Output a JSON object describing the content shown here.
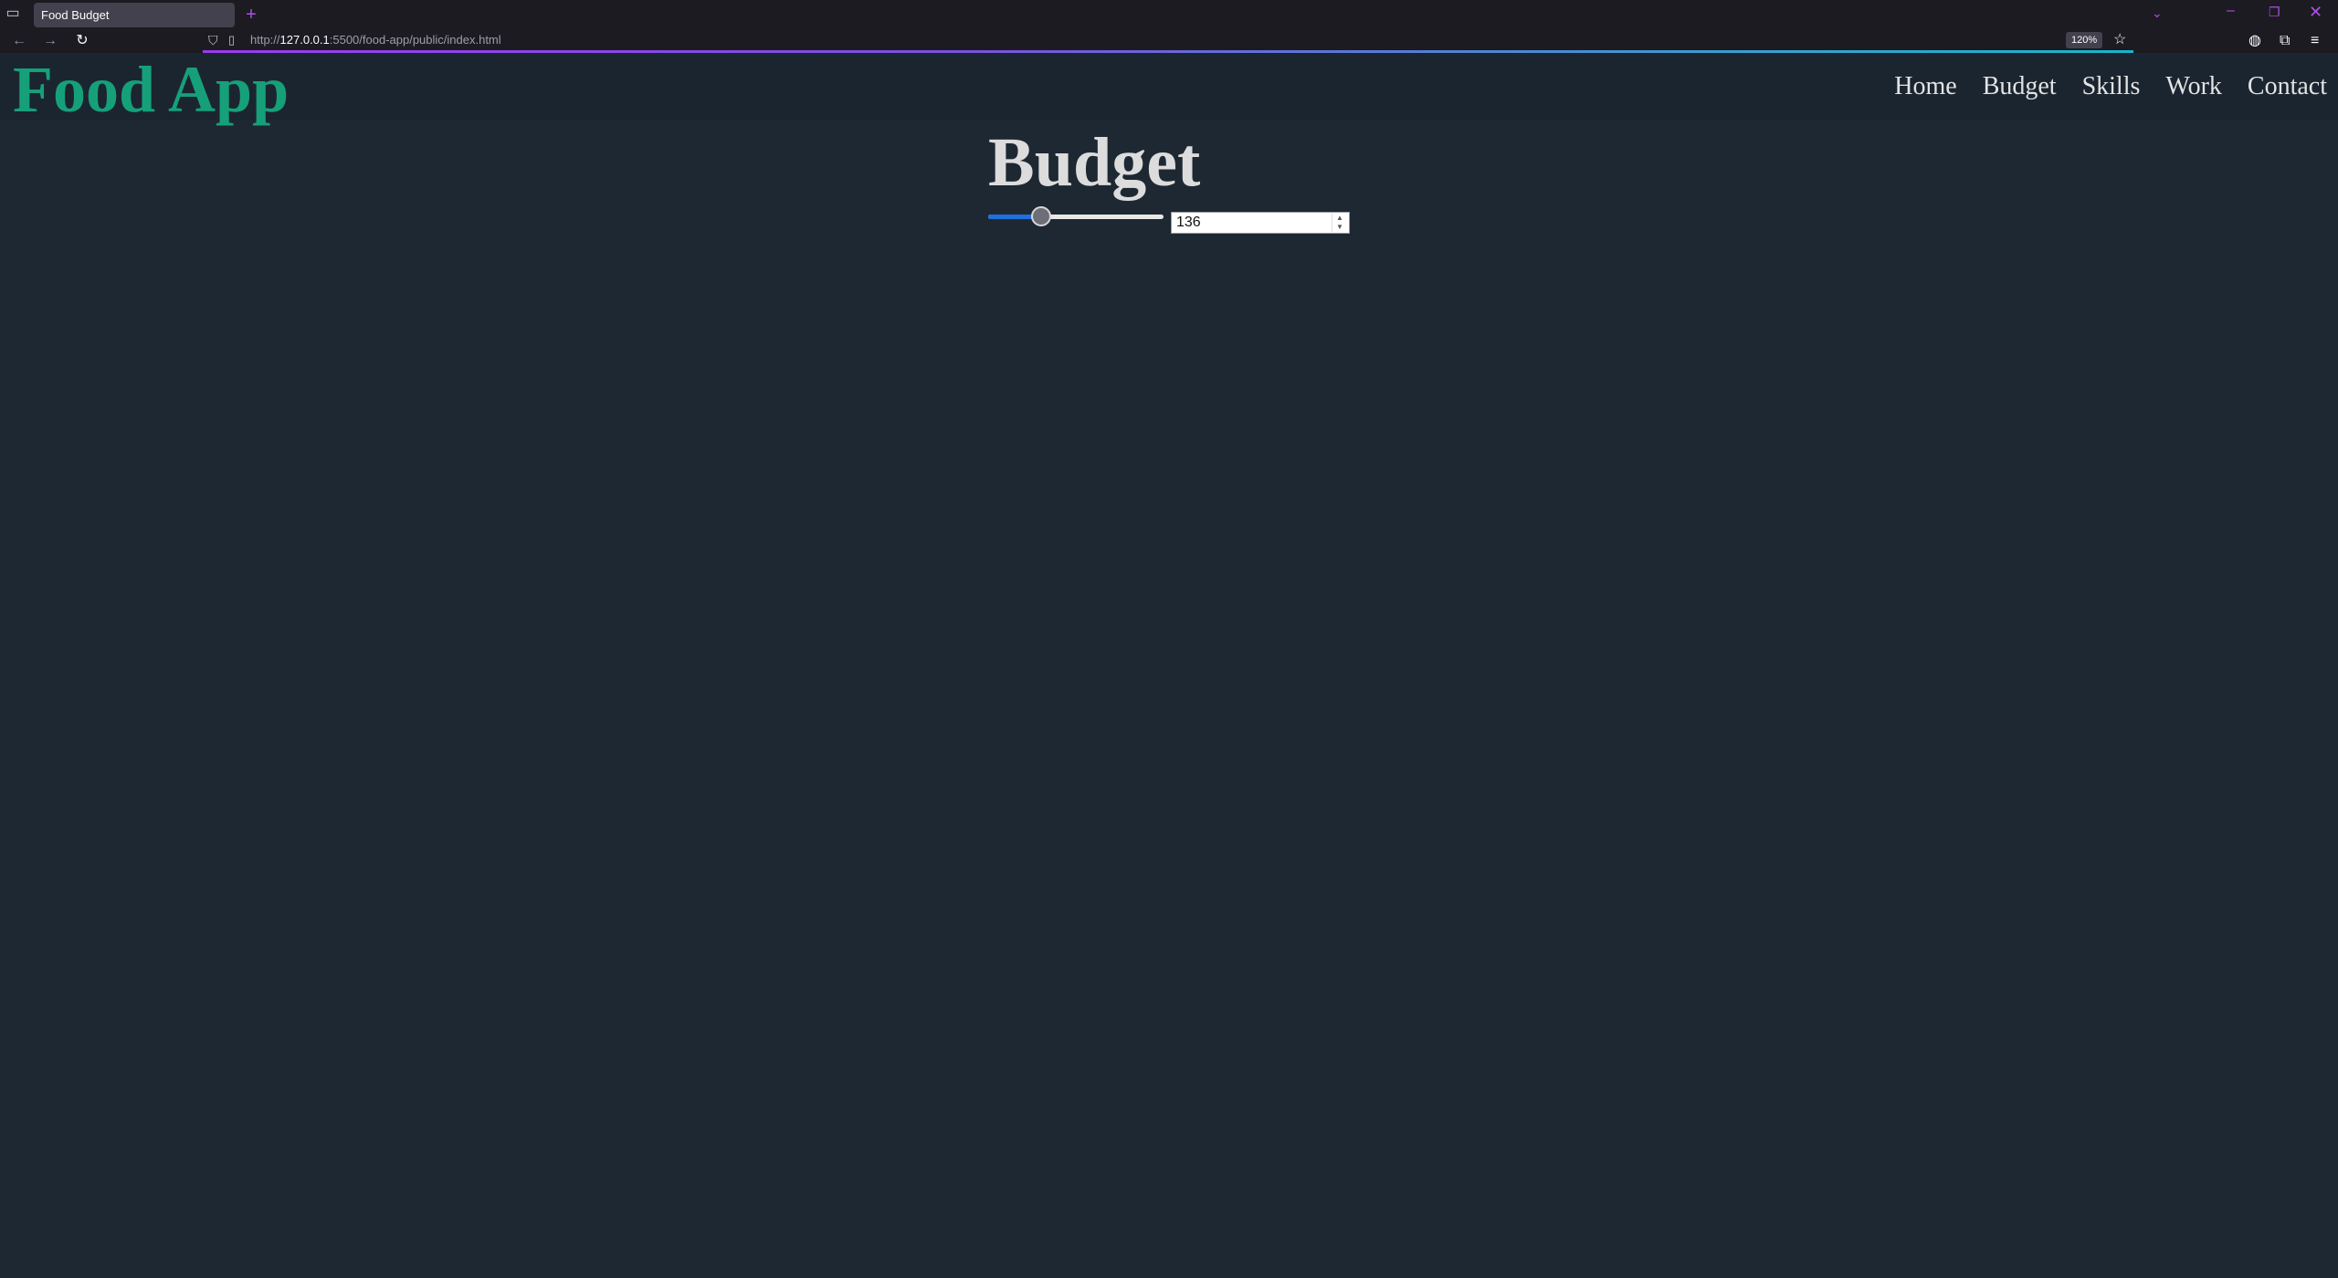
{
  "browser": {
    "tab_title": "Food Budget",
    "url_prefix": "http://",
    "url_host": "127.0.0.1",
    "url_rest": ":5500/food-app/public/index.html",
    "zoom": "120%"
  },
  "header": {
    "logo": "Food App",
    "nav": [
      "Home",
      "Budget",
      "Skills",
      "Work",
      "Contact"
    ]
  },
  "main": {
    "title": "Budget",
    "budget_input_value": "136",
    "slider_fraction": 0.3
  },
  "colors": {
    "page_background": "#1e2833",
    "header_background": "#1b2530",
    "logo": "#16a07a",
    "slider_fill": "#1f6fe0"
  }
}
